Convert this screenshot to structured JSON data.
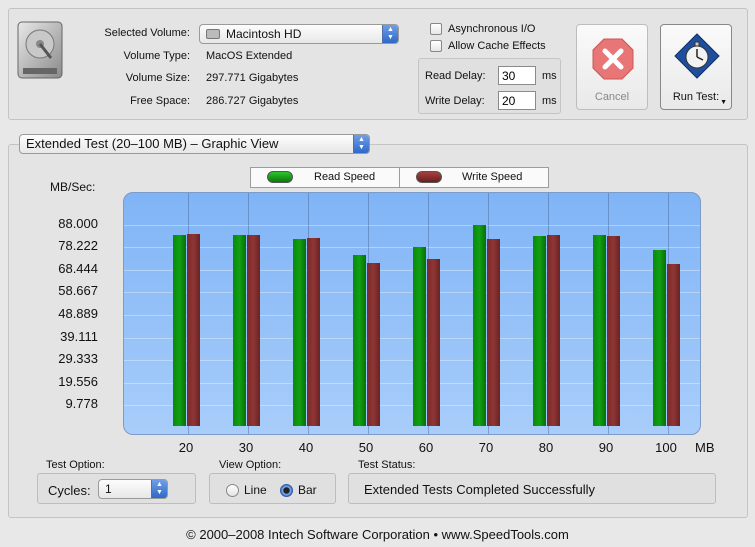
{
  "volume": {
    "selected_label": "Selected Volume:",
    "selected_value": "Macintosh HD",
    "type_label": "Volume Type:",
    "type_value": "MacOS Extended",
    "size_label": "Volume Size:",
    "size_value": "297.771 Gigabytes",
    "free_label": "Free Space:",
    "free_value": "286.727 Gigabytes"
  },
  "options": {
    "async_label": "Asynchronous I/O",
    "async_checked": false,
    "cache_label": "Allow Cache Effects",
    "cache_checked": false,
    "read_delay_label": "Read Delay:",
    "read_delay_value": "30",
    "write_delay_label": "Write Delay:",
    "write_delay_value": "20",
    "delay_unit": "ms"
  },
  "buttons": {
    "cancel_label": "Cancel",
    "run_label": "Run Test:"
  },
  "graph": {
    "mode_value": "Extended Test (20–100 MB) – Graphic View",
    "legend_read": "Read Speed",
    "legend_write": "Write Speed",
    "y_unit": "MB/Sec:",
    "x_unit": "MB"
  },
  "chart_data": {
    "type": "bar",
    "categories": [
      "20",
      "30",
      "40",
      "50",
      "60",
      "70",
      "80",
      "90",
      "100"
    ],
    "series": [
      {
        "name": "Read Speed",
        "color": "#12a012",
        "values": [
          82.8,
          82.8,
          81.0,
          73.9,
          77.4,
          87.0,
          82.4,
          82.6,
          76.2
        ]
      },
      {
        "name": "Write Speed",
        "color": "#8f3535",
        "values": [
          83.0,
          82.8,
          81.4,
          70.4,
          72.3,
          81.0,
          82.6,
          82.0,
          70.2
        ]
      }
    ],
    "y_ticks": [
      "88.000",
      "78.222",
      "68.444",
      "58.667",
      "48.889",
      "39.111",
      "29.333",
      "19.556",
      "9.778"
    ],
    "ylabel": "MB/Sec:",
    "xlabel": "MB",
    "ylim": [
      0,
      97.778
    ],
    "legend": "top-center",
    "grid": true
  },
  "bottom": {
    "test_option_label": "Test Option:",
    "cycles_label": "Cycles:",
    "cycles_value": "1",
    "view_option_label": "View Option:",
    "view_line_label": "Line",
    "view_bar_label": "Bar",
    "view_selected": "Bar",
    "status_label": "Test Status:",
    "status_value": "Extended Tests Completed Successfully"
  },
  "footer": "© 2000–2008 Intech Software Corporation • www.SpeedTools.com"
}
